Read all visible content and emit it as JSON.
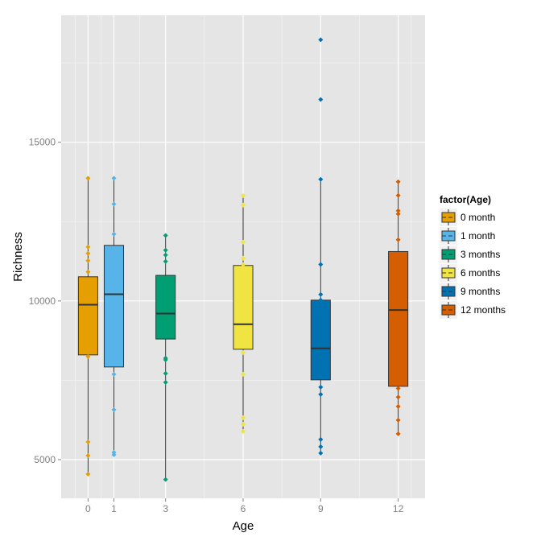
{
  "chart_data": {
    "type": "box",
    "title": "",
    "xlabel": "Age",
    "ylabel": "Richness",
    "xlim": [
      -1.04,
      13.04
    ],
    "ylim": [
      3780,
      19000
    ],
    "x_ticks": [
      0,
      1,
      3,
      6,
      9,
      12
    ],
    "x_tick_labels": [
      "0",
      "1",
      "3",
      "6",
      "9",
      "12"
    ],
    "x_minor_gridlines": [
      -0.5,
      0.5,
      2,
      4.5,
      7.5,
      10.5,
      12.5
    ],
    "y_ticks": [
      5000,
      10000,
      15000
    ],
    "y_tick_labels": [
      "5000",
      "10000",
      "15000"
    ],
    "y_minor_gridlines": [
      7500,
      12500,
      17500
    ],
    "grid": true,
    "background": "#E5E5E5",
    "gridline_color": "#FFFFFF",
    "box_width": 0.75,
    "legend": {
      "title": "factor(Age)",
      "position": "right",
      "entries": [
        "0 month",
        "1 month",
        "3 months",
        "6 months",
        "9 months",
        "12 months"
      ]
    },
    "series": [
      {
        "name": "0 month",
        "x": 0,
        "color": "#E69F00",
        "whisker_low": 4543,
        "q1": 8300,
        "median": 9881,
        "q3": 10761,
        "whisker_high": 13865,
        "points": [
          13865,
          11700,
          11497,
          11269,
          10914,
          8249,
          5559,
          5127,
          4543
        ]
      },
      {
        "name": "1 month",
        "x": 1,
        "color": "#56B4E9",
        "whisker_low": 5152,
        "q1": 7919,
        "median": 10211,
        "q3": 11751,
        "whisker_high": 13865,
        "points": [
          13865,
          13053,
          12107,
          7690,
          6574,
          5228,
          5152
        ]
      },
      {
        "name": "3 months",
        "x": 3,
        "color": "#009E73",
        "whisker_low": 4373,
        "q1": 8800,
        "median": 9602,
        "q3": 10805,
        "whisker_high": 12063,
        "points": [
          12063,
          11599,
          11447,
          11244,
          8198,
          8147,
          7716,
          7437,
          4373
        ]
      },
      {
        "name": "6 months",
        "x": 6,
        "color": "#F0E442",
        "whisker_low": 5888,
        "q1": 8477,
        "median": 9264,
        "q3": 11117,
        "whisker_high": 13317,
        "points": [
          13317,
          13020,
          11853,
          11345,
          11142,
          8376,
          7690,
          6320,
          6117,
          5888
        ]
      },
      {
        "name": "9 months",
        "x": 9,
        "color": "#0072B2",
        "whisker_low": 5203,
        "q1": 7513,
        "median": 8503,
        "q3": 10025,
        "whisker_high": 13832,
        "points": [
          18231,
          16345,
          13832,
          11150,
          10203,
          10025,
          7284,
          7056,
          5635,
          5406,
          5203
        ]
      },
      {
        "name": "12 months",
        "x": 12,
        "color": "#D55E00",
        "whisker_low": 5812,
        "q1": 7310,
        "median": 9713,
        "q3": 11556,
        "whisker_high": 13756,
        "points": [
          13756,
          13325,
          12843,
          12741,
          11929,
          7241,
          6970,
          6675,
          6244,
          5812
        ]
      }
    ]
  }
}
